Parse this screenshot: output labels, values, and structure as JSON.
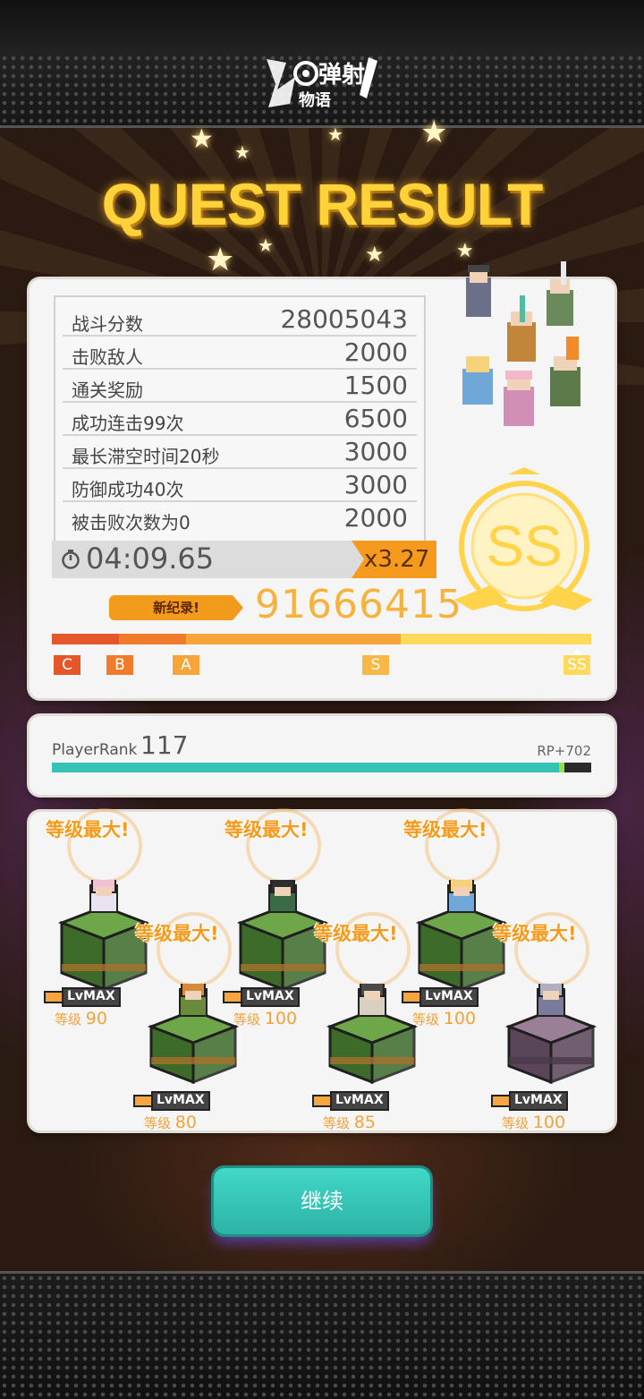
{
  "header": {
    "logo_text": "弹射物语",
    "title": "QUEST RESULT"
  },
  "score_rows": [
    {
      "label": "战斗分数",
      "value": "28005043"
    },
    {
      "label": "击败敌人",
      "value": "2000"
    },
    {
      "label": "通关奖励",
      "value": "1500"
    },
    {
      "label": "成功连击99次",
      "value": "6500"
    },
    {
      "label": "最长滞空时间20秒",
      "value": "3000"
    },
    {
      "label": "防御成功40次",
      "value": "3000"
    },
    {
      "label": "被击败次数为0",
      "value": "2000"
    }
  ],
  "timer": {
    "time": "04:09.65",
    "multiplier": "x3.27"
  },
  "new_record_label": "新纪录!",
  "total_score": "91666415",
  "rank": "SS",
  "grades": [
    "C",
    "B",
    "A",
    "S",
    "SS"
  ],
  "score_progress_fraction": 1.0,
  "player_rank": {
    "label": "PlayerRank",
    "value": "117",
    "rp": "RP+702",
    "progress_fraction": 0.94
  },
  "units": [
    {
      "max_label": "等级最大!",
      "lv_tag": "LvMAX",
      "level_prefix": "等级",
      "level": "90",
      "base": "grass"
    },
    {
      "max_label": "等级最大!",
      "lv_tag": "LvMAX",
      "level_prefix": "等级",
      "level": "80",
      "base": "grass"
    },
    {
      "max_label": "等级最大!",
      "lv_tag": "LvMAX",
      "level_prefix": "等级",
      "level": "100",
      "base": "grass"
    },
    {
      "max_label": "等级最大!",
      "lv_tag": "LvMAX",
      "level_prefix": "等级",
      "level": "85",
      "base": "grass"
    },
    {
      "max_label": "等级最大!",
      "lv_tag": "LvMAX",
      "level_prefix": "等级",
      "level": "100",
      "base": "grass"
    },
    {
      "max_label": "等级最大!",
      "lv_tag": "LvMAX",
      "level_prefix": "等级",
      "level": "100",
      "base": "stone"
    }
  ],
  "continue_label": "继续",
  "colors": {
    "accent": "#f59a1c",
    "teal": "#33c2b3",
    "gold": "#ffd23a"
  }
}
